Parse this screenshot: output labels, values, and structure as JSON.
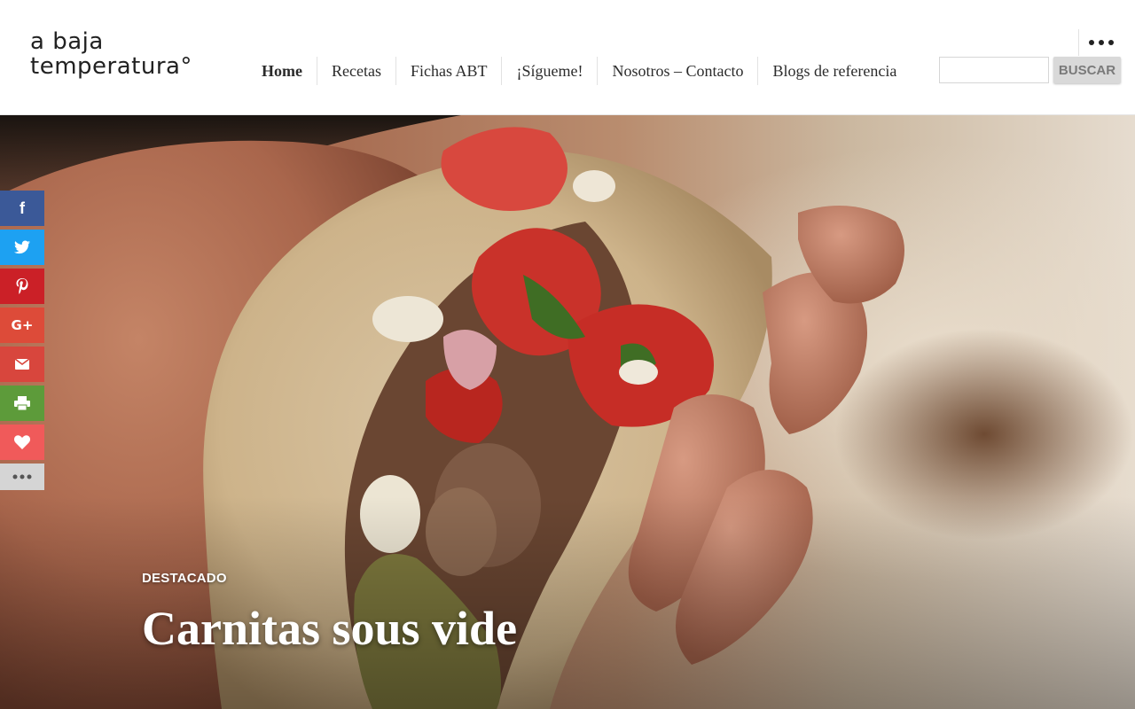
{
  "logo": {
    "line1": "a baja",
    "line2": "temperatura°"
  },
  "nav": {
    "items": [
      "Home",
      "Recetas",
      "Fichas ABT",
      "¡Sígueme!",
      "Nosotros – Contacto",
      "Blogs de referencia"
    ]
  },
  "search": {
    "value": "",
    "button_label": "BUSCAR"
  },
  "hero": {
    "category_label": "DESTACADO",
    "title": "Carnitas sous vide"
  },
  "share": {
    "buttons": [
      {
        "icon": "facebook-icon",
        "glyph": "f",
        "color": "#3b5998"
      },
      {
        "icon": "twitter-icon",
        "color": "#1da1f2"
      },
      {
        "icon": "pinterest-icon",
        "glyph": "P",
        "color": "#cb2027"
      },
      {
        "icon": "google-plus-icon",
        "glyph": "G+",
        "color": "#dd4b39"
      },
      {
        "icon": "email-icon",
        "color": "#d8463d"
      },
      {
        "icon": "print-icon",
        "color": "#5d9b3a"
      },
      {
        "icon": "heart-icon",
        "color": "#f05a5a"
      },
      {
        "icon": "more-icon",
        "color": "#d5d5d5"
      }
    ]
  },
  "colors": {
    "text": "#2b2b2b",
    "header_bg": "#ffffff",
    "search_button_bg": "#d9d9d9"
  }
}
